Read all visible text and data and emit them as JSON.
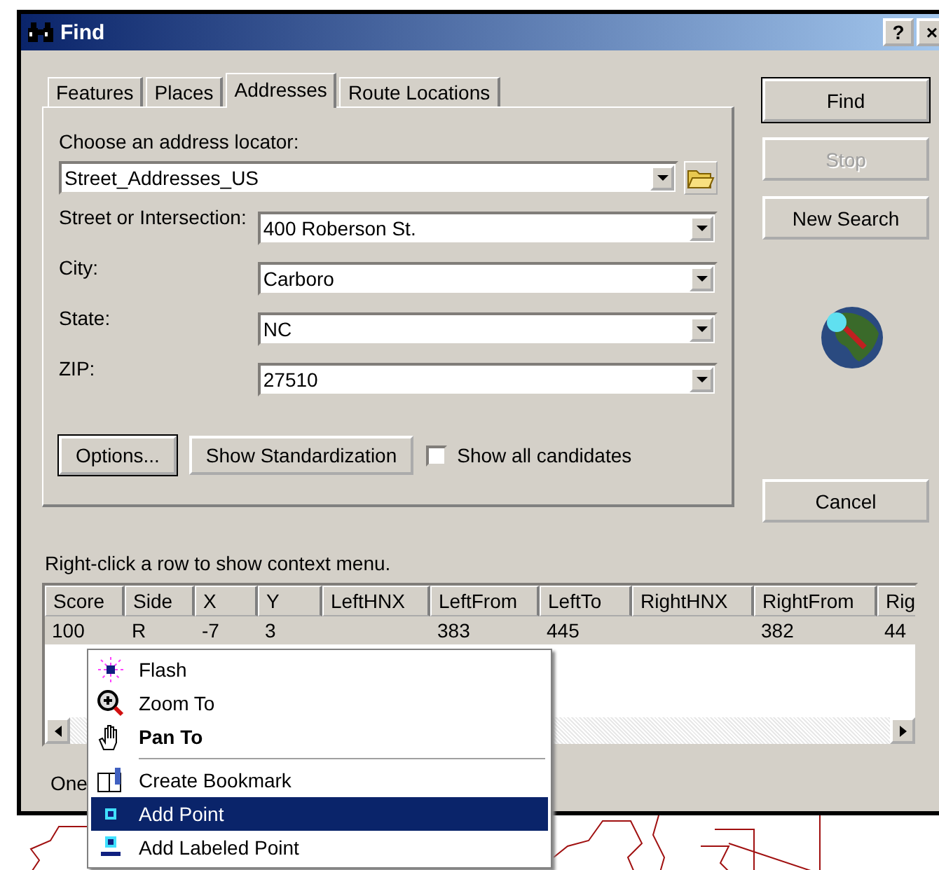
{
  "window": {
    "title": "Find",
    "help": "?",
    "close": "×"
  },
  "tabs": [
    {
      "label": "Features",
      "selected": false
    },
    {
      "label": "Places",
      "selected": false
    },
    {
      "label": "Addresses",
      "selected": true
    },
    {
      "label": "Route Locations",
      "selected": false
    }
  ],
  "locator": {
    "label": "Choose an address locator:",
    "value": "Street_Addresses_US"
  },
  "fields": [
    {
      "label": "Street or Intersection:",
      "value": "400 Roberson St."
    },
    {
      "label": "City:",
      "value": "Carboro"
    },
    {
      "label": "State:",
      "value": "NC"
    },
    {
      "label": "ZIP:",
      "value": "27510"
    }
  ],
  "panel_buttons": [
    {
      "label": "Options...",
      "default": true
    },
    {
      "label": "Show Standardization",
      "default": false
    }
  ],
  "show_all_candidates": {
    "label": "Show all candidates",
    "checked": false
  },
  "side_buttons": [
    {
      "label": "Find",
      "disabled": false,
      "default": true
    },
    {
      "label": "Stop",
      "disabled": true,
      "default": false
    },
    {
      "label": "New Search",
      "disabled": false,
      "default": false
    }
  ],
  "cancel_button": {
    "label": "Cancel"
  },
  "results_hint": "Right-click a row to show context menu.",
  "table": {
    "columns": [
      "Score",
      "Side",
      "X",
      "Y",
      "LeftHNX",
      "LeftFrom",
      "LeftTo",
      "RightHNX",
      "RightFrom",
      "Rig"
    ],
    "rows": [
      {
        "selected": true,
        "cells": [
          "100",
          "R",
          "-7",
          "3",
          "",
          "383",
          "445",
          "",
          "382",
          "44"
        ]
      }
    ]
  },
  "status": "One",
  "context_menu": [
    {
      "kind": "item",
      "label": "Flash",
      "selected": false,
      "default": false
    },
    {
      "kind": "item",
      "label": "Zoom To",
      "selected": false,
      "default": false
    },
    {
      "kind": "item",
      "label": "Pan To",
      "selected": false,
      "default": true
    },
    {
      "kind": "separator"
    },
    {
      "kind": "item",
      "label": "Create Bookmark",
      "selected": false,
      "default": false
    },
    {
      "kind": "item",
      "label": "Add Point",
      "selected": true,
      "default": false
    },
    {
      "kind": "item",
      "label": "Add Labeled Point",
      "selected": false,
      "default": false
    }
  ]
}
